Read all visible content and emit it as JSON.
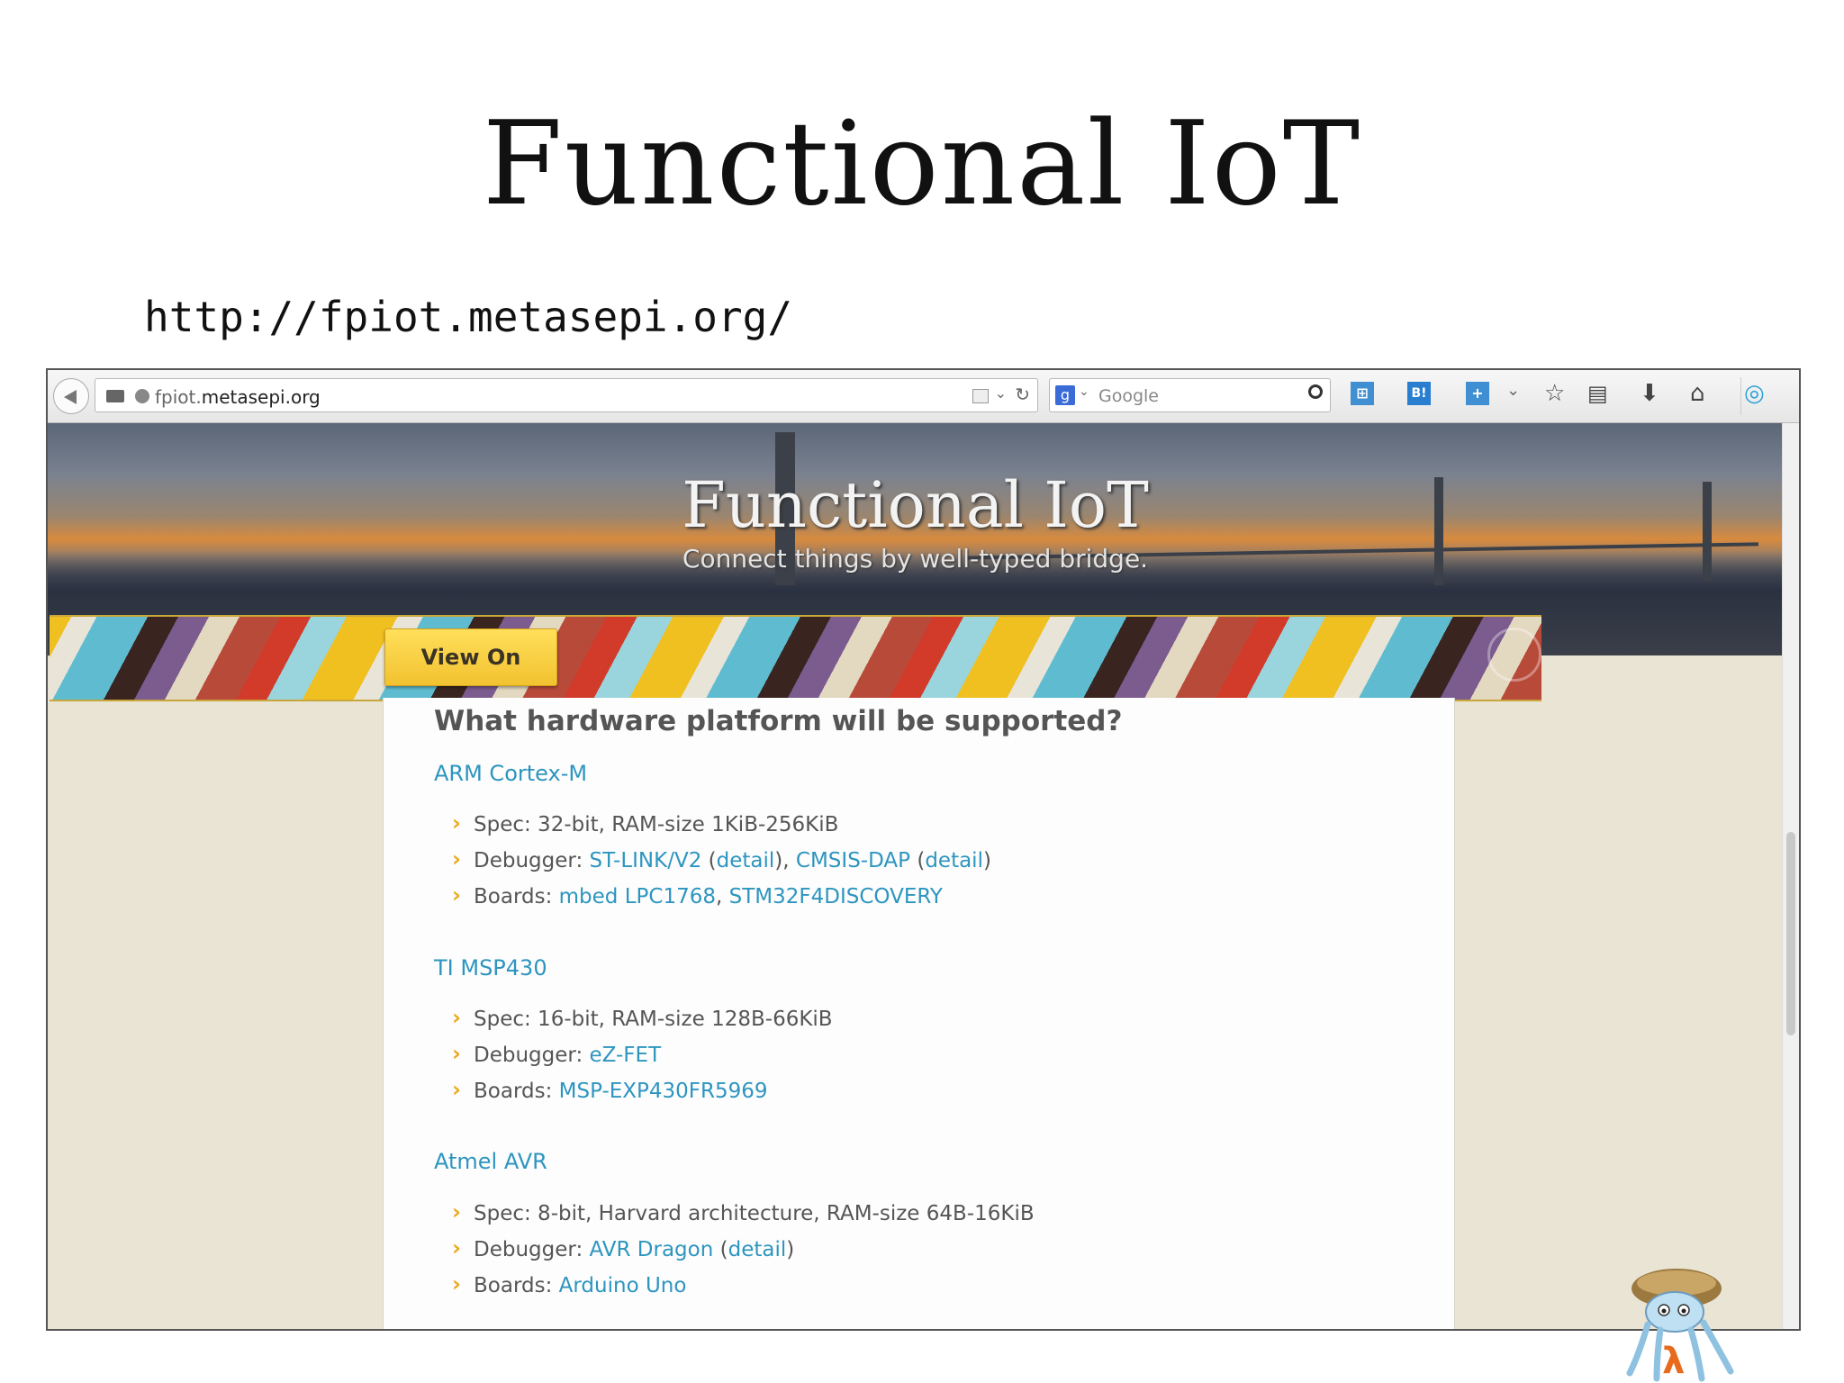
{
  "slide": {
    "title": "Functional IoT",
    "url": "http://fpiot.metasepi.org/"
  },
  "browser": {
    "url_prefix": "fpiot.",
    "url_domain": "metasepi.org",
    "search_placeholder": "Google",
    "icons": [
      "back-icon",
      "folder-icon",
      "globe-icon",
      "reader-icon",
      "reload-icon",
      "search-engine-icon",
      "magnifier-icon",
      "hatena-icon",
      "hatena-bookmark-icon",
      "bookmark-add-icon",
      "star-icon",
      "clipboard-icon",
      "download-icon",
      "home-icon",
      "sync-icon",
      "menu-icon"
    ],
    "hatena_label": "B!"
  },
  "page": {
    "hero_title": "Functional IoT",
    "hero_subtitle": "Connect things by well-typed bridge.",
    "github_button": "View On GitHub",
    "heading": "What hardware platform will be supported?",
    "sections": [
      {
        "title": "ARM Cortex-M",
        "spec": "Spec: 32-bit, RAM-size 1KiB-256KiB",
        "debugger_label": "Debugger: ",
        "debugger_links": [
          "ST-LINK/V2",
          "detail",
          "CMSIS-DAP",
          "detail"
        ],
        "boards_label": "Boards: ",
        "boards_links": [
          "mbed LPC1768",
          "STM32F4DISCOVERY"
        ]
      },
      {
        "title": "TI MSP430",
        "spec": "Spec: 16-bit, RAM-size 128B-66KiB",
        "debugger_label": "Debugger: ",
        "debugger_links": [
          "eZ-FET"
        ],
        "boards_label": "Boards: ",
        "boards_links": [
          "MSP-EXP430FR5969"
        ]
      },
      {
        "title": "Atmel AVR",
        "spec": "Spec: 8-bit, Harvard architecture, RAM-size 64B-16KiB",
        "debugger_label": "Debugger: ",
        "debugger_links": [
          "AVR Dragon",
          "detail"
        ],
        "boards_label": "Boards: ",
        "boards_links": [
          "Arduino Uno"
        ]
      }
    ]
  },
  "colors": {
    "link": "#2d95bf",
    "bullet": "#e8a920",
    "button": "#f2c230",
    "page_bg": "#e9e4d4"
  }
}
